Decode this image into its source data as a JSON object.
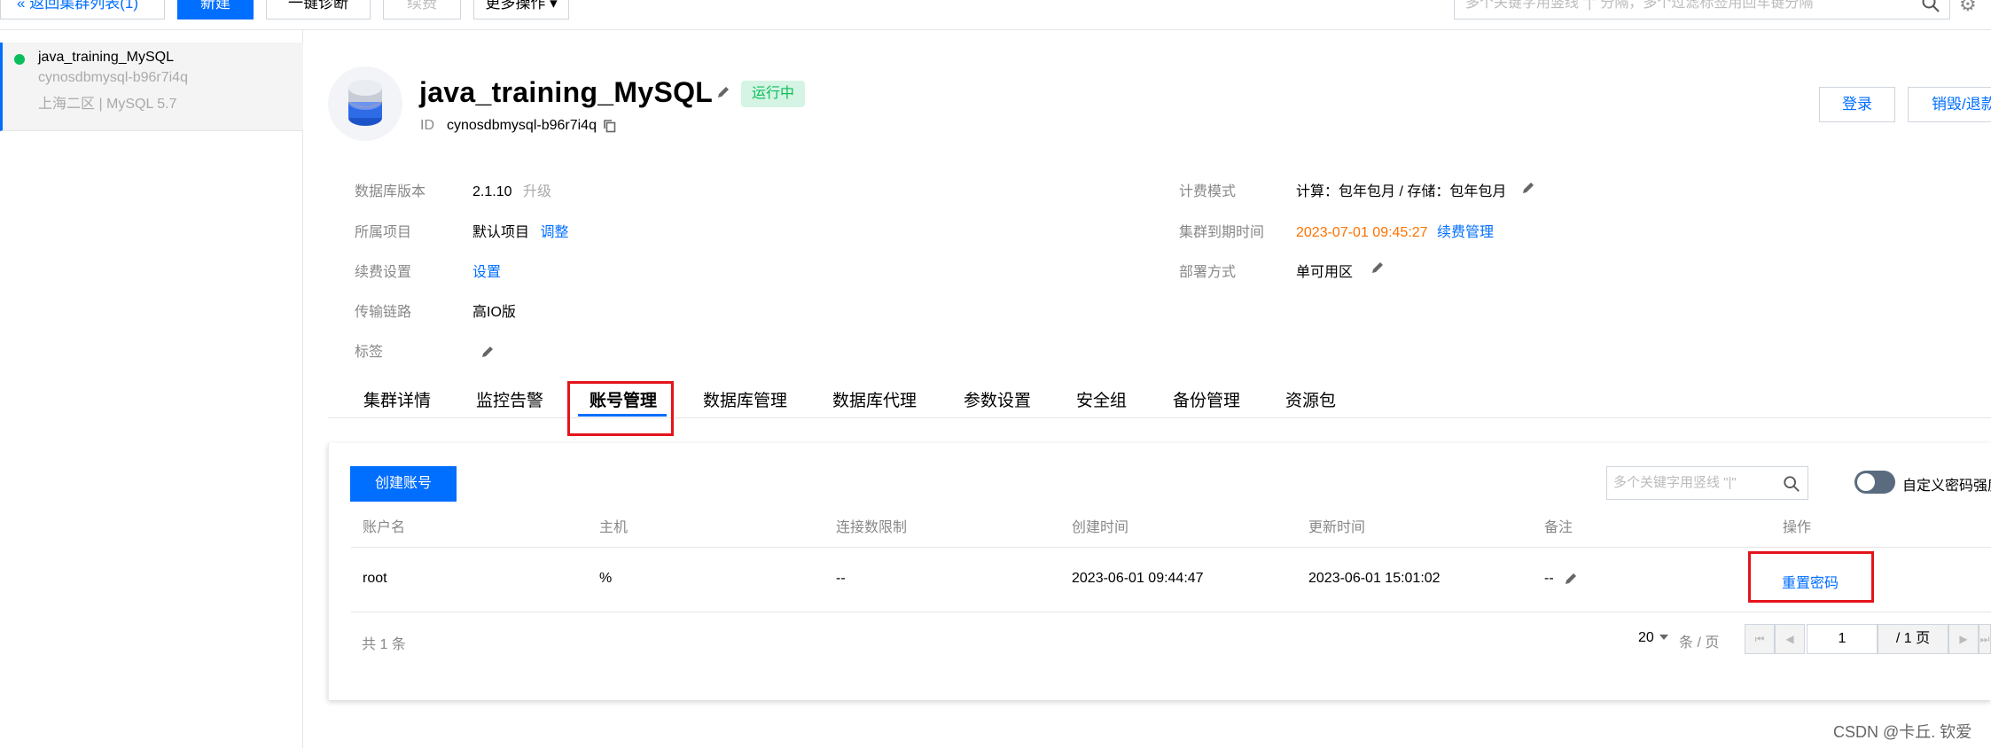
{
  "toolbar": {
    "back_label": "返回集群列表(1)",
    "new_label": "新建",
    "diagnose_label": "一键诊断",
    "sync_label": "续费",
    "more_label": "更多操作",
    "search_placeholder": "多个关键字用竖线 \"|\" 分隔，多个过滤标签用回车键分隔"
  },
  "sidebar": {
    "cluster": {
      "name": "java_training_MySQL",
      "id": "cynosdbmysql-b96r7i4q",
      "region": "上海二区 | MySQL 5.7",
      "status_color": "#0abf5b"
    }
  },
  "header": {
    "title": "java_training_MySQL",
    "status": "运行中",
    "id_label": "ID",
    "id_value": "cynosdbmysql-b96r7i4q",
    "login_label": "登录",
    "destroy_label": "销毁/退款"
  },
  "info": {
    "left": [
      {
        "label": "数据库版本",
        "value": "2.1.10",
        "extra": "升级"
      },
      {
        "label": "所属项目",
        "value": "默认项目",
        "extra": "调整"
      },
      {
        "label": "续费设置",
        "value": "设置"
      },
      {
        "label": "传输链路",
        "value": "高IO版"
      },
      {
        "label": "标签",
        "value": ""
      }
    ],
    "right": [
      {
        "label": "计费模式",
        "value": "计算：包年包月 / 存储：包年包月"
      },
      {
        "label": "集群到期时间",
        "value": "2023-07-01 09:45:27",
        "extra": "续费管理"
      },
      {
        "label": "部署方式",
        "value": "单可用区"
      }
    ]
  },
  "tabs": [
    {
      "label": "集群详情"
    },
    {
      "label": "监控告警"
    },
    {
      "label": "账号管理",
      "active": true
    },
    {
      "label": "数据库管理"
    },
    {
      "label": "数据库代理"
    },
    {
      "label": "参数设置"
    },
    {
      "label": "安全组"
    },
    {
      "label": "备份管理"
    },
    {
      "label": "资源包"
    }
  ],
  "accounts": {
    "create_label": "创建账号",
    "search_placeholder": "多个关键字用竖线 \"|\"",
    "toggle_label": "自定义密码强度",
    "columns": [
      "账户名",
      "主机",
      "连接数限制",
      "创建时间",
      "更新时间",
      "备注",
      "操作"
    ],
    "rows": [
      {
        "name": "root",
        "host": "%",
        "limit": "--",
        "created": "2023-06-01 09:44:47",
        "updated": "2023-06-01 15:01:02",
        "note": "--",
        "action": "重置密码"
      }
    ],
    "total": "共 1 条",
    "page_size": "20",
    "page_unit": "条 / 页",
    "page_current": "1",
    "page_total": "/ 1 页"
  },
  "watermark": "CSDN @卡丘. 钦爱",
  "colors": {
    "accent": "#006eff",
    "running": "#0abf5b",
    "highlight": "#e4141b",
    "expire": "#ff7200"
  }
}
